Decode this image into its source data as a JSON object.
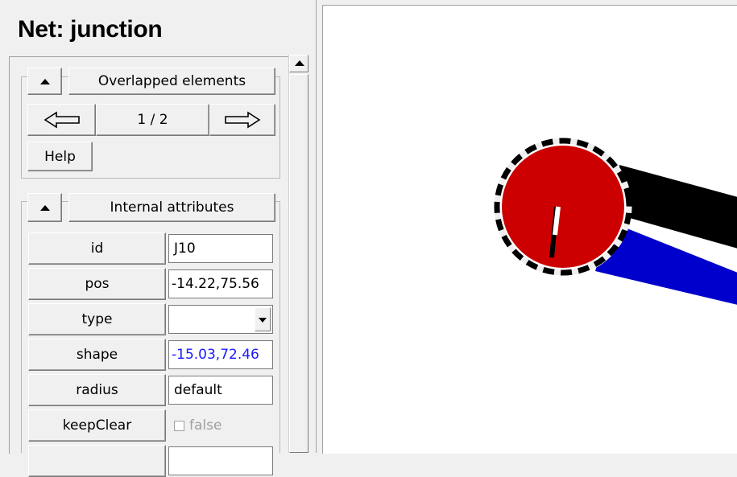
{
  "panel": {
    "title": "Net: junction",
    "overlapped": {
      "label": "Overlapped elements",
      "counter": "1 / 2",
      "prev_icon": "arrow-left-icon",
      "next_icon": "arrow-right-icon",
      "help_label": "Help"
    },
    "attributes": {
      "label": "Internal attributes",
      "rows": [
        {
          "name": "id",
          "value": "J10"
        },
        {
          "name": "pos",
          "value": "-14.22,75.56"
        },
        {
          "name": "type",
          "value": ""
        },
        {
          "name": "shape",
          "value": "-15.03,72.46"
        },
        {
          "name": "radius",
          "value": "default"
        },
        {
          "name": "keepClear",
          "value": "false"
        }
      ]
    }
  },
  "canvas": {
    "background": "#ffffff",
    "junction_color": "#cc0000",
    "edge_colors": [
      "#000000",
      "#0000cc"
    ]
  }
}
